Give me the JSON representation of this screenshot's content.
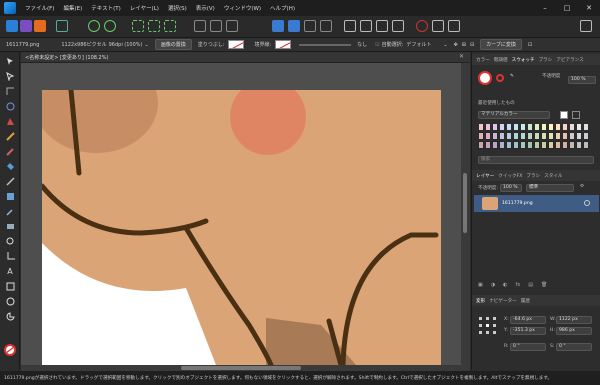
{
  "menu": {
    "items": [
      "ファイル(F)",
      "編集(E)",
      "テキスト(T)",
      "レイヤー(L)",
      "選択(S)",
      "表示(V)",
      "ウィンドウ(W)",
      "ヘルプ(H)"
    ]
  },
  "context": {
    "filename": "1611779.png",
    "dimensions": "1122x986ピクセル",
    "dpi": "96dpi (100%)",
    "replace_button": "画像の置換",
    "fill_label": "塗りつぶし:",
    "border_label": "境界線:",
    "none_label": "なし",
    "auto_select_label": "自動選択:",
    "auto_select_value": "デフォルト",
    "convert_button": "カーブに変換"
  },
  "document": {
    "tab_title": "<名称未設定> [変更あり] (108.2%)"
  },
  "panels": {
    "color_tabs": [
      "カラー",
      "階調値",
      "スウォッチ",
      "ブラシ",
      "アピアランス"
    ],
    "color_active": "スウォッチ",
    "opacity_label": "不透明度",
    "opacity_value": "100 %",
    "recent_label": "最近使用したもの",
    "palette_name": "マテリアルカラー",
    "search_placeholder": "検索",
    "layer_tabs": [
      "レイヤー",
      "クイックFX",
      "ブラシ",
      "スタイル"
    ],
    "layer_active": "レイヤー",
    "layer_opacity_label": "不透明度:",
    "layer_opacity_value": "100 %",
    "blend_mode": "標準",
    "layer_name": "1611779.png",
    "transform_tabs": [
      "変形",
      "ナビゲーター",
      "履歴"
    ],
    "transform_active": "変形",
    "x_label": "X:",
    "x_value": "-64.6 px",
    "y_label": "Y:",
    "y_value": "-351.3 px",
    "w_label": "W:",
    "w_value": "1122 px",
    "h_label": "H:",
    "h_value": "986 px",
    "r_label": "R:",
    "r_value": "0 °",
    "s_label": "S:",
    "s_value": "0 °"
  },
  "status": {
    "text": "1611779.pngが選択されています。ドラッグで選択範囲を移動します。クリックで別のオブジェクトを選択します。何もない領域をクリックすると、選択が解除されます。Shiftで制約します。Ctrlで選択したオブジェクトを複製します。Altでスナップを無視します。"
  },
  "colors": {
    "accent": "#4a8fd8",
    "image_bg": "#dba476",
    "line": "#4a3013",
    "circle": "#e08563",
    "shadow": "#c78e66",
    "layer_row": "#3f5c85"
  }
}
